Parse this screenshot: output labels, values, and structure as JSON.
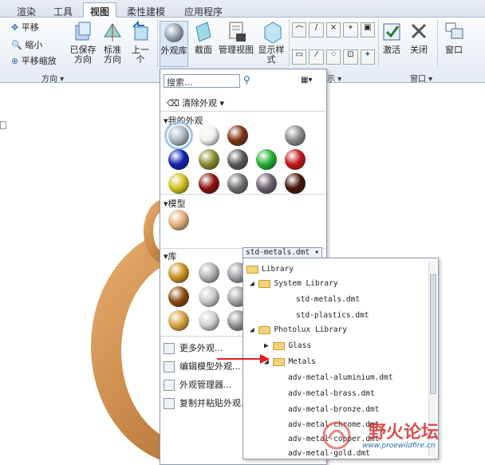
{
  "tabs": [
    "渲染",
    "工具",
    "视图",
    "柔性建模",
    "应用程序"
  ],
  "ribbon": {
    "left_items": [
      "平移",
      "缩小",
      "平移缩放"
    ],
    "saved_dir": "已保存\n方向",
    "standard_dir": "标准\n方向",
    "prev": "上一\n个",
    "appearance_lib": "外观库",
    "section": "截面",
    "manage_views": "管理视图",
    "display_style": "显示样\n式",
    "activate": "激活",
    "close": "关闭",
    "window": "窗口",
    "group_direction": "方向",
    "group_display_suffix": "示",
    "group_window": "窗口"
  },
  "panel": {
    "search_placeholder": "搜索...",
    "clear_appearance": "清除外观",
    "my_appearances": "我的外观",
    "model": "模型",
    "library": "库",
    "library_dropdown": "std-metals.dmt",
    "menu": [
      "更多外观...",
      "编辑模型外观...",
      "外观管理器...",
      "复制并粘贴外观..."
    ]
  },
  "tree": {
    "items": [
      "Library",
      "System Library",
      "std-metals.dmt",
      "std-plastics.dmt",
      "Photolux Library",
      "Glass",
      "Metals",
      "adv-metal-aluminium.dmt",
      "adv-metal-brass.dmt",
      "adv-metal-bronze.dmt",
      "adv-metal-chrome.dmt",
      "adv-metal-copper.dmt",
      "adv-metal-gold.dmt"
    ]
  },
  "watermark": {
    "title": "野火论坛",
    "url": "www.proewildfire.cn"
  },
  "colors": {
    "my": [
      "#aab6c4",
      "#f0f0ec",
      "#7a3414",
      "#8a8a8a",
      "#1020b0",
      "#8a8a30",
      "#5a5a5a",
      "#20b030",
      "#c01818",
      "#d0c020",
      "#8a1010",
      "#707070",
      "#6a6070",
      "#4a1408"
    ],
    "model": [
      "#e0b078"
    ],
    "lib": [
      "#c89020",
      "#b0b0b0",
      "#9a9aa0",
      "#8a4a10",
      "#c8c8c8",
      "#a0a0a0",
      "#d8a040",
      "#d0d0d0",
      "#909090"
    ]
  }
}
